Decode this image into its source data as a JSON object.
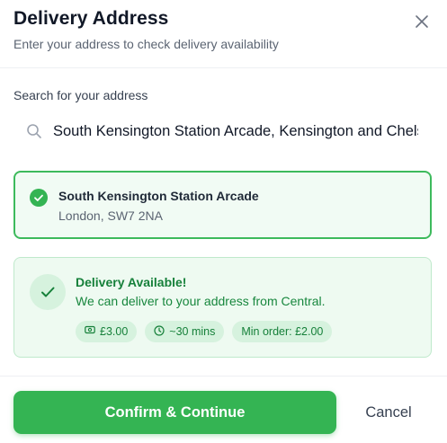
{
  "dialog": {
    "title": "Delivery Address",
    "subtitle": "Enter your address to check delivery availability",
    "close_icon": "close-icon"
  },
  "search": {
    "label": "Search for your address",
    "value": "South Kensington Station Arcade, Kensington and Chelsea",
    "icon": "search-icon"
  },
  "selected_address": {
    "name": "South Kensington Station Arcade",
    "detail": "London, SW7 2NA",
    "icon": "check-circle-icon"
  },
  "availability": {
    "title": "Delivery Available!",
    "message": "We can deliver to your address from Central.",
    "icon": "check-icon",
    "badges": {
      "fee": "£3.00",
      "time": "~30 mins",
      "min_order": "Min order: £2.00"
    }
  },
  "actions": {
    "confirm_label": "Confirm & Continue",
    "cancel_label": "Cancel"
  },
  "colors": {
    "accent": "#34b453",
    "success_text": "#16803a",
    "success_bg": "#eefaf1"
  }
}
